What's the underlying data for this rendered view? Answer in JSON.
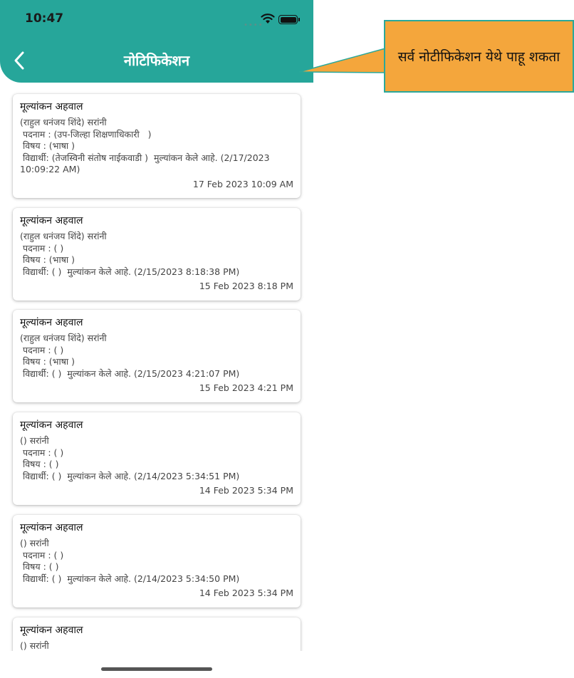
{
  "status_bar": {
    "time": "10:47"
  },
  "header": {
    "title": "नोटिफिकेशन"
  },
  "notifications": [
    {
      "title": "मूल्यांकन अहवाल",
      "lines": [
        "(राहुल धनंजय शिंदे) सरांनी",
        " पदनाम : (उप-जिल्हा शिक्षणाधिकारी   )",
        " विषय : (भाषा )",
        " विद्यार्थी: (तेजस्विनी संतोष नाईकवाडी )  मुल्यांकन केले आहे. (2/17/2023 10:09:22 AM)"
      ],
      "date": "17 Feb 2023 10:09 AM"
    },
    {
      "title": "मूल्यांकन अहवाल",
      "lines": [
        "(राहुल धनंजय शिंदे) सरांनी",
        " पदनाम : ( )",
        " विषय : (भाषा )",
        " विद्यार्थी: ( )  मुल्यांकन केले आहे. (2/15/2023 8:18:38 PM)"
      ],
      "date": "15 Feb 2023 8:18 PM"
    },
    {
      "title": "मूल्यांकन अहवाल",
      "lines": [
        "(राहुल धनंजय शिंदे) सरांनी",
        " पदनाम : ( )",
        " विषय : (भाषा )",
        " विद्यार्थी: ( )  मुल्यांकन केले आहे. (2/15/2023 4:21:07 PM)"
      ],
      "date": "15 Feb 2023 4:21 PM"
    },
    {
      "title": "मूल्यांकन अहवाल",
      "lines": [
        "() सरांनी",
        " पदनाम : ( )",
        " विषय : ( )",
        " विद्यार्थी: ( )  मुल्यांकन केले आहे. (2/14/2023 5:34:51 PM)"
      ],
      "date": "14 Feb 2023 5:34 PM"
    },
    {
      "title": "मूल्यांकन अहवाल",
      "lines": [
        "() सरांनी",
        " पदनाम : ( )",
        " विषय : ( )",
        " विद्यार्थी: ( )  मुल्यांकन केले आहे. (2/14/2023 5:34:50 PM)"
      ],
      "date": "14 Feb 2023 5:34 PM"
    },
    {
      "title": "मूल्यांकन अहवाल",
      "lines": [
        "() सरांनी"
      ],
      "date": ""
    }
  ],
  "callout": {
    "text": "सर्व नोटीफिकेशन येथे पाहू शकता"
  },
  "colors": {
    "header": "#26a69a",
    "callout": "#f4a63c",
    "callout_border": "#2aa89a"
  },
  "icons": {
    "back": "chevron-left-icon",
    "wifi": "wifi-icon",
    "battery": "battery-icon"
  }
}
